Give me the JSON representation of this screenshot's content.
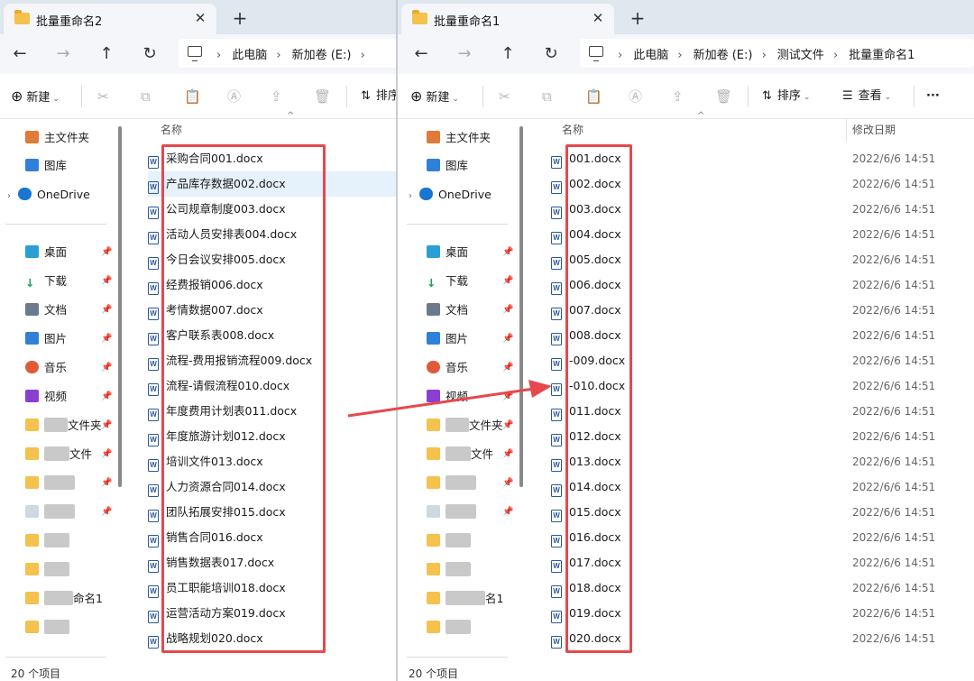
{
  "left_window": {
    "tab_title": "批量重命名2",
    "crumbs": [
      "此电脑",
      "新加卷 (E:)"
    ],
    "toolbar": {
      "new_label": "新建",
      "sort_label": "排序"
    },
    "header_name": "名称",
    "files": [
      "采购合同001.docx",
      "产品库存数据002.docx",
      "公司规章制度003.docx",
      "活动人员安排表004.docx",
      "今日会议安排005.docx",
      "经费报销006.docx",
      "考情数据007.docx",
      "客户联系表008.docx",
      "流程-费用报销流程009.docx",
      "流程-请假流程010.docx",
      "年度费用计划表011.docx",
      "年度旅游计划012.docx",
      "培训文件013.docx",
      "人力资源合同014.docx",
      "团队拓展安排015.docx",
      "销售合同016.docx",
      "销售数据表017.docx",
      "员工职能培训018.docx",
      "运营活动方案019.docx",
      "战略规划020.docx"
    ],
    "status": "20 个项目"
  },
  "right_window": {
    "tab_title": "批量重命名1",
    "crumbs": [
      "此电脑",
      "新加卷 (E:)",
      "测试文件",
      "批量重命名1"
    ],
    "toolbar": {
      "new_label": "新建",
      "sort_label": "排序",
      "view_label": "查看",
      "more_label": "···"
    },
    "header_name": "名称",
    "header_date": "修改日期",
    "files": [
      "001.docx",
      "002.docx",
      "003.docx",
      "004.docx",
      "005.docx",
      "006.docx",
      "007.docx",
      "008.docx",
      "-009.docx",
      "-010.docx",
      "011.docx",
      "012.docx",
      "013.docx",
      "014.docx",
      "015.docx",
      "016.docx",
      "017.docx",
      "018.docx",
      "019.docx",
      "020.docx"
    ],
    "date": "2022/6/6 14:51",
    "status": "20 个项目"
  },
  "sidebar": {
    "home": "主文件夹",
    "gallery": "图库",
    "onedrive": "OneDrive",
    "desktop": "桌面",
    "downloads": "下载",
    "documents": "文档",
    "pictures": "图片",
    "music": "音乐",
    "videos": "视频",
    "folder_a": "文件夹",
    "folder_b": "文件",
    "folder_c": "命名1",
    "folder_c2": "名1"
  },
  "colors": {
    "highlight_box": "#e8474c",
    "arrow": "#e8474c",
    "selection": "#e5f1fb",
    "folder": "#f4c24d",
    "word_icon": "#2b5797"
  },
  "icons": [
    "folder-icon",
    "close-icon",
    "plus-icon",
    "back-icon",
    "forward-icon",
    "up-icon",
    "refresh-icon",
    "computer-icon",
    "new-icon",
    "cut-icon",
    "copy-icon",
    "paste-icon",
    "rename-icon",
    "share-icon",
    "delete-icon",
    "sort-icon",
    "view-icon",
    "more-icon",
    "home-icon",
    "gallery-icon",
    "cloud-icon",
    "pin-icon",
    "word-file-icon"
  ]
}
